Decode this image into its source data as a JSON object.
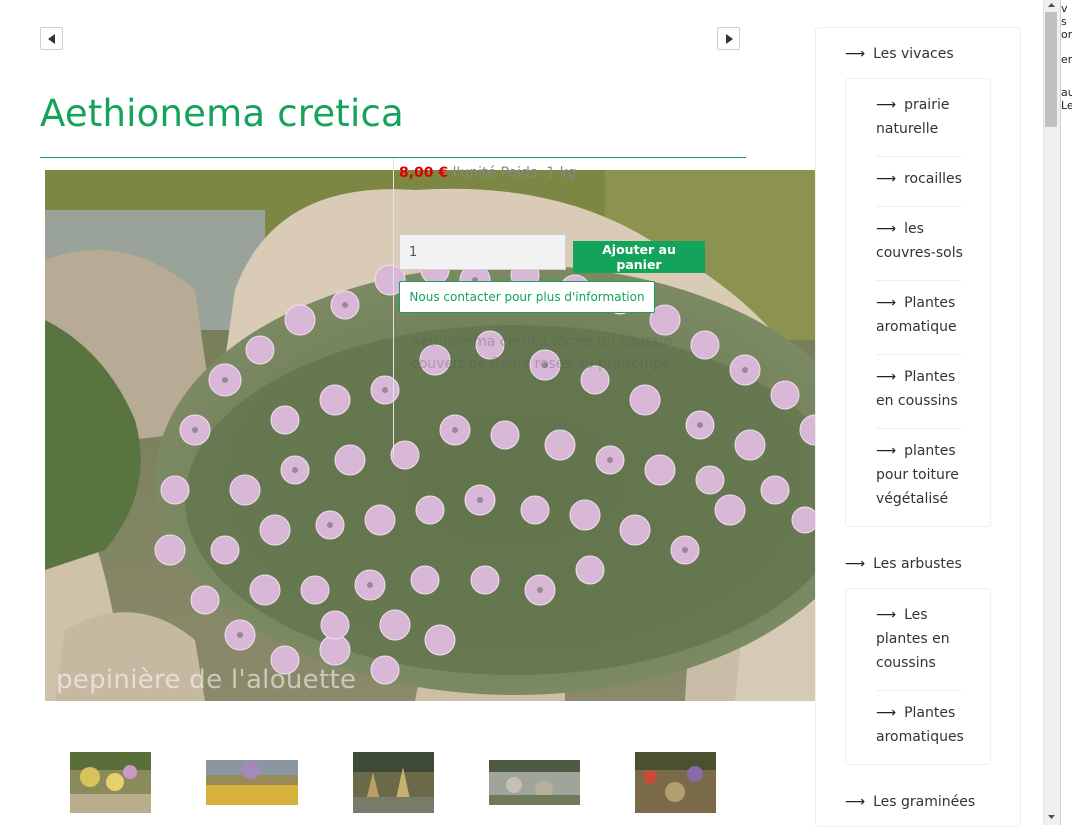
{
  "product": {
    "title": "Aethionema cretica",
    "price": "8,00 €",
    "price_suffix": "l'unité Poids: 1 kg",
    "quantity": "1",
    "add_to_cart": "Ajouter au panier",
    "contact": "Nous contacter pour plus d'information",
    "description": "Aethionema cretica forme un coussin couvert de fleurs roses au printemps.",
    "watermark": "pepinière de l'alouette"
  },
  "sidebar": {
    "categories": [
      {
        "label": "Les vivaces",
        "items": [
          {
            "line1": "prairie",
            "line2": "naturelle"
          },
          {
            "line1": "rocailles"
          },
          {
            "line1": "les",
            "line2": "couvres-sols"
          },
          {
            "line1": "Plantes",
            "line2": "aromatique"
          },
          {
            "line1": "Plantes",
            "line2": "en coussins"
          },
          {
            "line1": "plantes",
            "line2": "pour toiture",
            "line3": "végétalisé"
          }
        ]
      },
      {
        "label": "Les arbustes",
        "items": [
          {
            "line1": "Les",
            "line2": "plantes en",
            "line3": "coussins"
          },
          {
            "line1": "Plantes",
            "line2": "aromatiques"
          }
        ]
      },
      {
        "label": "Les graminées",
        "items": []
      }
    ]
  },
  "icons": {
    "prev": "chevron-left-icon",
    "next": "chevron-right-icon",
    "arrow": "long-arrow-right-icon"
  },
  "colors": {
    "brand_green": "#14a35a",
    "price_red": "#e00000"
  },
  "right_pane": {
    "fragments": [
      "v",
      "s",
      "on",
      "er",
      "au",
      "Le"
    ]
  }
}
